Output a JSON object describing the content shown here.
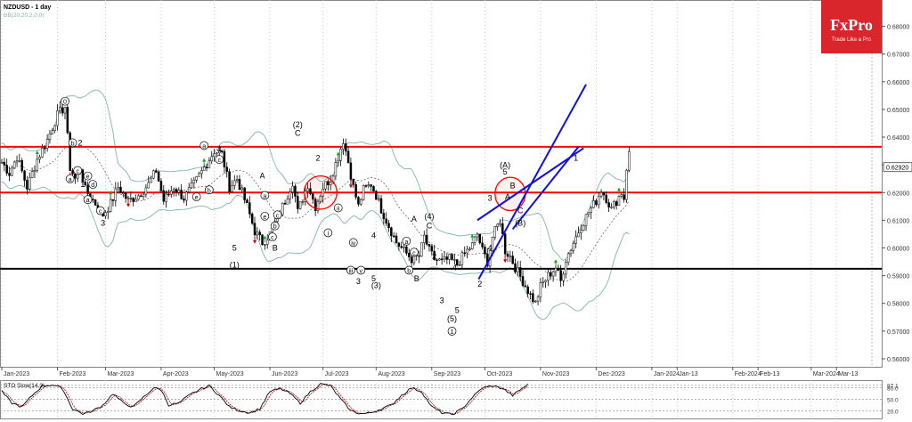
{
  "chart_data": {
    "type": "candlestick",
    "symbol_label": "NZDUSD - 1 day",
    "indicator_label": "BB(20,20,2,0,0)",
    "brand": {
      "name": "FxPro",
      "tagline": "Trade Like a Pro",
      "color": "#d9262c"
    },
    "colors": {
      "resistance": "#ff0000",
      "support": "#000000",
      "channel": "#1010e0",
      "bands": "#7fb5ad",
      "middle": "#555555",
      "sto_main": "#000000",
      "sto_signal": "#b10000",
      "up_arrow": "#1e9e1e",
      "down_arrow": "#cc0000"
    },
    "price_axis": {
      "ylim": [
        0.5571,
        0.6895
      ],
      "ticks": [
        "0.68000",
        "0.67000",
        "0.66000",
        "0.65000",
        "0.64000",
        "0.63000",
        "0.62000",
        "0.61000",
        "0.60000",
        "0.59000",
        "0.58000",
        "0.57000",
        "0.56000"
      ],
      "current_price": "0.62920",
      "current_value": 0.6292
    },
    "time_axis": {
      "labels": [
        "Jan-2023",
        "Feb-2023",
        "Mar-2023",
        "Apr-2023",
        "May-2023",
        "Jun-2023",
        "Jul-2023",
        "Aug-2023",
        "Sep-2023",
        "Oct-2023",
        "Nov-2023",
        "Dec-2023",
        "Jan-2024",
        "Jan-13",
        "Feb-2024",
        "Feb-13",
        "Mar-2024",
        "Mar-13"
      ],
      "bar_index": [
        0,
        22,
        41,
        63,
        84,
        106,
        127,
        148,
        170,
        191,
        213,
        235,
        257,
        267,
        289,
        299,
        320,
        330
      ]
    },
    "resistance_levels": [
      0.6365,
      0.62
    ],
    "support_level": 0.5925,
    "price_path": [
      [
        0,
        0.631
      ],
      [
        3,
        0.627
      ],
      [
        6,
        0.633
      ],
      [
        10,
        0.622
      ],
      [
        14,
        0.632
      ],
      [
        18,
        0.639
      ],
      [
        22,
        0.648
      ],
      [
        25,
        0.651
      ],
      [
        27,
        0.629
      ],
      [
        29,
        0.625
      ],
      [
        31,
        0.629
      ],
      [
        33,
        0.621
      ],
      [
        37,
        0.616
      ],
      [
        40,
        0.612
      ],
      [
        43,
        0.616
      ],
      [
        46,
        0.622
      ],
      [
        50,
        0.617
      ],
      [
        54,
        0.619
      ],
      [
        58,
        0.623
      ],
      [
        61,
        0.628
      ],
      [
        64,
        0.617
      ],
      [
        68,
        0.622
      ],
      [
        72,
        0.618
      ],
      [
        76,
        0.623
      ],
      [
        80,
        0.629
      ],
      [
        84,
        0.635
      ],
      [
        87,
        0.634
      ],
      [
        90,
        0.622
      ],
      [
        93,
        0.625
      ],
      [
        97,
        0.615
      ],
      [
        100,
        0.606
      ],
      [
        103,
        0.602
      ],
      [
        106,
        0.605
      ],
      [
        109,
        0.611
      ],
      [
        112,
        0.617
      ],
      [
        115,
        0.624
      ],
      [
        117,
        0.613
      ],
      [
        119,
        0.618
      ],
      [
        121,
        0.623
      ],
      [
        124,
        0.615
      ],
      [
        127,
        0.622
      ],
      [
        130,
        0.625
      ],
      [
        133,
        0.633
      ],
      [
        135,
        0.639
      ],
      [
        137,
        0.631
      ],
      [
        139,
        0.622
      ],
      [
        141,
        0.615
      ],
      [
        143,
        0.621
      ],
      [
        146,
        0.623
      ],
      [
        148,
        0.619
      ],
      [
        150,
        0.614
      ],
      [
        153,
        0.608
      ],
      [
        156,
        0.602
      ],
      [
        159,
        0.599
      ],
      [
        162,
        0.596
      ],
      [
        165,
        0.597
      ],
      [
        167,
        0.604
      ],
      [
        169,
        0.599
      ],
      [
        171,
        0.596
      ],
      [
        174,
        0.595
      ],
      [
        177,
        0.596
      ],
      [
        180,
        0.594
      ],
      [
        183,
        0.598
      ],
      [
        186,
        0.601
      ],
      [
        188,
        0.605
      ],
      [
        190,
        0.599
      ],
      [
        192,
        0.595
      ],
      [
        194,
        0.604
      ],
      [
        197,
        0.61
      ],
      [
        199,
        0.599
      ],
      [
        201,
        0.597
      ],
      [
        203,
        0.593
      ],
      [
        206,
        0.588
      ],
      [
        209,
        0.583
      ],
      [
        211,
        0.58
      ],
      [
        213,
        0.586
      ],
      [
        216,
        0.59
      ],
      [
        219,
        0.593
      ],
      [
        221,
        0.588
      ],
      [
        223,
        0.596
      ],
      [
        226,
        0.602
      ],
      [
        229,
        0.608
      ],
      [
        232,
        0.613
      ],
      [
        235,
        0.617
      ],
      [
        237,
        0.621
      ],
      [
        239,
        0.618
      ],
      [
        241,
        0.614
      ],
      [
        243,
        0.617
      ],
      [
        245,
        0.62
      ],
      [
        246,
        0.618
      ],
      [
        247,
        0.629
      ],
      [
        248,
        0.634
      ]
    ],
    "waves": [
      {
        "t": "0",
        "i": 25,
        "p": 0.652,
        "c": 1
      },
      {
        "t": "b",
        "i": 28,
        "p": 0.637,
        "c": 1
      },
      {
        "t": "2",
        "i": 31,
        "p": 0.637,
        "c": 0
      },
      {
        "t": "a",
        "i": 27,
        "p": 0.624,
        "c": 1
      },
      {
        "t": "c",
        "i": 30,
        "p": 0.627,
        "c": 1
      },
      {
        "t": "e",
        "i": 34,
        "p": 0.625,
        "c": 1
      },
      {
        "t": "1",
        "i": 32,
        "p": 0.622,
        "c": 0
      },
      {
        "t": "d",
        "i": 36,
        "p": 0.622,
        "c": 1
      },
      {
        "t": "a",
        "i": 34,
        "p": 0.6165,
        "c": 1
      },
      {
        "t": "c",
        "i": 39,
        "p": 0.6125,
        "c": 1
      },
      {
        "t": "3",
        "i": 40,
        "p": 0.608,
        "c": 0
      },
      {
        "t": "a",
        "i": 80,
        "p": 0.636,
        "c": 1
      },
      {
        "t": "c",
        "i": 86,
        "p": 0.631,
        "c": 1
      },
      {
        "t": "4",
        "i": 86,
        "p": 0.6345,
        "c": 0
      },
      {
        "t": "b",
        "i": 82,
        "p": 0.62,
        "c": 1
      },
      {
        "t": "e",
        "i": 77,
        "p": 0.6175,
        "c": 1
      },
      {
        "t": "5",
        "i": 92,
        "p": 0.599,
        "c": 0
      },
      {
        "t": "(1)",
        "i": 92,
        "p": 0.593,
        "c": 0
      },
      {
        "t": "a",
        "i": 104,
        "p": 0.618,
        "c": 1
      },
      {
        "t": "A",
        "i": 103,
        "p": 0.625,
        "c": 0
      },
      {
        "t": "c",
        "i": 109,
        "p": 0.611,
        "c": 1
      },
      {
        "t": "e",
        "i": 104,
        "p": 0.6105,
        "c": 1
      },
      {
        "t": "b",
        "i": 108,
        "p": 0.607,
        "c": 1
      },
      {
        "t": "c",
        "i": 107,
        "p": 0.603,
        "c": 1
      },
      {
        "t": "B",
        "i": 108,
        "p": 0.599,
        "c": 0
      },
      {
        "t": "(2)",
        "i": 117,
        "p": 0.6435,
        "c": 0
      },
      {
        "t": "C",
        "i": 117,
        "p": 0.6405,
        "c": 0
      },
      {
        "t": "2",
        "i": 125,
        "p": 0.6315,
        "c": 0
      },
      {
        "t": "ii",
        "i": 133,
        "p": 0.6135,
        "c": 1
      },
      {
        "t": "i",
        "i": 129,
        "p": 0.6045,
        "c": 1
      },
      {
        "t": "iv",
        "i": 139,
        "p": 0.601,
        "c": 1
      },
      {
        "t": "4",
        "i": 147,
        "p": 0.6035,
        "c": 0
      },
      {
        "t": "iii",
        "i": 138,
        "p": 0.591,
        "c": 1
      },
      {
        "t": "v",
        "i": 142,
        "p": 0.591,
        "c": 1
      },
      {
        "t": "3",
        "i": 141,
        "p": 0.587,
        "c": 0
      },
      {
        "t": "5",
        "i": 147,
        "p": 0.588,
        "c": 0
      },
      {
        "t": "(3)",
        "i": 148,
        "p": 0.5855,
        "c": 0
      },
      {
        "t": "A",
        "i": 163,
        "p": 0.6095,
        "c": 0
      },
      {
        "t": "a",
        "i": 160,
        "p": 0.6015,
        "c": 1
      },
      {
        "t": "c",
        "i": 163,
        "p": 0.5975,
        "c": 1
      },
      {
        "t": "(4)",
        "i": 169,
        "p": 0.6105,
        "c": 0
      },
      {
        "t": "C",
        "i": 169,
        "p": 0.607,
        "c": 0
      },
      {
        "t": "b",
        "i": 161,
        "p": 0.591,
        "c": 1
      },
      {
        "t": "B",
        "i": 164,
        "p": 0.588,
        "c": 0
      },
      {
        "t": "2",
        "i": 171,
        "p": 0.596,
        "c": 0
      },
      {
        "t": "4",
        "i": 179,
        "p": 0.592,
        "c": 0
      },
      {
        "t": "3",
        "i": 174,
        "p": 0.58,
        "c": 0
      },
      {
        "t": "5",
        "i": 180,
        "p": 0.5765,
        "c": 0
      },
      {
        "t": "(5)",
        "i": 178,
        "p": 0.5735,
        "c": 0
      },
      {
        "t": "1",
        "i": 178,
        "p": 0.569,
        "c": 1
      },
      {
        "t": "(A)",
        "i": 199,
        "p": 0.629,
        "c": 0
      },
      {
        "t": "5",
        "i": 199,
        "p": 0.6265,
        "c": 0
      },
      {
        "t": "B",
        "i": 202,
        "p": 0.6215,
        "c": 0
      },
      {
        "t": "3",
        "i": 193,
        "p": 0.617,
        "c": 0
      },
      {
        "t": "A",
        "i": 200,
        "p": 0.6175,
        "c": 0
      },
      {
        "t": "4",
        "i": 193,
        "p": 0.599,
        "c": 0
      },
      {
        "t": "C",
        "i": 205,
        "p": 0.6125,
        "c": 0
      },
      {
        "t": "(B)",
        "i": 205,
        "p": 0.608,
        "c": 0
      },
      {
        "t": "2",
        "i": 189,
        "p": 0.586,
        "c": 0
      },
      {
        "t": "1",
        "i": 227,
        "p": 0.6315,
        "c": 0
      }
    ],
    "channel": [
      {
        "from": [
          188.5,
          0.5887
        ],
        "to": [
          231,
          0.659
        ]
      },
      {
        "from": [
          188,
          0.61
        ],
        "to": [
          230,
          0.636
        ]
      },
      {
        "from": [
          202,
          0.6068
        ],
        "to": [
          228,
          0.6365
        ]
      }
    ],
    "ellipses": [
      {
        "i": 126,
        "p": 0.62,
        "ri": 6.5,
        "rp": 0.006
      },
      {
        "i": 201,
        "p": 0.6195,
        "ri": 6,
        "rp": 0.006
      }
    ],
    "stochastic": {
      "label": "STO Slow(14,3)",
      "ylim": [
        0,
        100
      ],
      "levels": [
        87.1,
        80.0,
        50.0,
        20.0
      ],
      "level_labels": [
        "87.1",
        "80.0",
        "50.0",
        "20.0"
      ],
      "main_path": [
        [
          0,
          70
        ],
        [
          4,
          40
        ],
        [
          8,
          30
        ],
        [
          12,
          60
        ],
        [
          16,
          85
        ],
        [
          20,
          88
        ],
        [
          24,
          78
        ],
        [
          28,
          25
        ],
        [
          32,
          12
        ],
        [
          36,
          20
        ],
        [
          40,
          35
        ],
        [
          44,
          65
        ],
        [
          48,
          40
        ],
        [
          52,
          30
        ],
        [
          56,
          55
        ],
        [
          60,
          80
        ],
        [
          63,
          75
        ],
        [
          66,
          35
        ],
        [
          70,
          40
        ],
        [
          74,
          60
        ],
        [
          78,
          75
        ],
        [
          82,
          85
        ],
        [
          86,
          60
        ],
        [
          90,
          30
        ],
        [
          94,
          20
        ],
        [
          98,
          15
        ],
        [
          102,
          25
        ],
        [
          106,
          70
        ],
        [
          110,
          78
        ],
        [
          114,
          65
        ],
        [
          118,
          40
        ],
        [
          122,
          70
        ],
        [
          126,
          90
        ],
        [
          130,
          85
        ],
        [
          134,
          50
        ],
        [
          138,
          20
        ],
        [
          142,
          12
        ],
        [
          146,
          15
        ],
        [
          150,
          25
        ],
        [
          154,
          35
        ],
        [
          158,
          60
        ],
        [
          162,
          80
        ],
        [
          166,
          70
        ],
        [
          170,
          30
        ],
        [
          174,
          15
        ],
        [
          178,
          10
        ],
        [
          182,
          25
        ],
        [
          186,
          55
        ],
        [
          190,
          80
        ],
        [
          194,
          85
        ],
        [
          198,
          78
        ],
        [
          202,
          60
        ],
        [
          206,
          80
        ],
        [
          208,
          88
        ]
      ]
    }
  }
}
